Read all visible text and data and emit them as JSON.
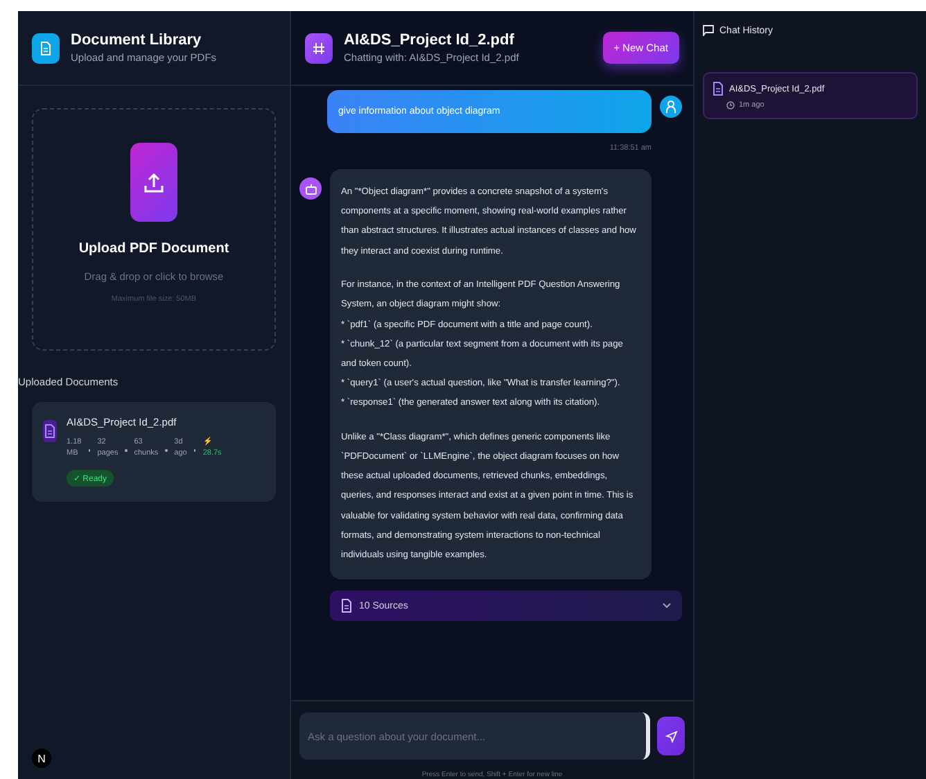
{
  "library": {
    "title": "Document Library",
    "subtitle": "Upload and manage your PDFs"
  },
  "upload": {
    "title": "Upload PDF Document",
    "hint": "Drag & drop or click to browse",
    "limit": "Maximum file size: 50MB"
  },
  "uploaded": {
    "heading": "Uploaded Documents",
    "documents": [
      {
        "name": "AI&DS_Project Id_2.pdf",
        "stats": [
          {
            "value": "1.18",
            "label": "MB"
          },
          {
            "value": "32",
            "label": "pages"
          },
          {
            "value": "63",
            "label": "chunks"
          },
          {
            "value": "3d",
            "label": "ago"
          },
          {
            "value": "⚡",
            "label": "28.7s"
          }
        ],
        "status": "✓ Ready"
      }
    ]
  },
  "user_avatar": "N",
  "chat": {
    "title": "AI&DS_Project Id_2.pdf",
    "subtitle": "Chatting with: AI&DS_Project Id_2.pdf",
    "new_chat": "+ New Chat"
  },
  "messages": [
    {
      "kind": "user",
      "text": "give information about object diagram",
      "time": "11:38:51 am"
    },
    {
      "kind": "assistant",
      "blocks": [
        {
          "kind": "paragraph",
          "text": "An \"*Object diagram*\" provides a concrete snapshot of a system's components at a specific moment, showing real-world examples rather than abstract structures. It illustrates actual instances of classes and how they interact and coexist during runtime."
        },
        {
          "kind": "paragraph",
          "text": "For instance, in the context of an Intelligent PDF Question Answering System, an object diagram might show:"
        },
        {
          "kind": "bullet",
          "text": "*   `pdf1` (a specific PDF document with a title and page count)."
        },
        {
          "kind": "bullet",
          "text": "*   `chunk_12` (a particular text segment from a document with its page and token count)."
        },
        {
          "kind": "bullet",
          "text": "*   `query1` (a user's actual question, like \"What is transfer learning?\")."
        },
        {
          "kind": "bullet",
          "text": "*   `response1` (the generated answer text along with its citation)."
        },
        {
          "kind": "paragraph",
          "text": "Unlike a \"*Class diagram*\", which defines generic components like `PDFDocument` or `LLMEngine`, the object diagram focuses on how these actual uploaded documents, retrieved chunks, embeddings, queries, and responses interact and exist at a given point in time. This is valuable for validating system behavior with real data, confirming data formats, and demonstrating system interactions to non-technical individuals using tangible examples."
        }
      ],
      "sources": "10 Sources",
      "expanded": false
    }
  ],
  "input": {
    "placeholder": "Ask a question about your document...",
    "hint": "Press Enter to send, Shift + Enter for new line"
  },
  "history": {
    "title": "Chat History",
    "items": [
      {
        "name": "AI&DS_Project Id_2.pdf",
        "time": "1m ago",
        "selected": true
      }
    ]
  }
}
